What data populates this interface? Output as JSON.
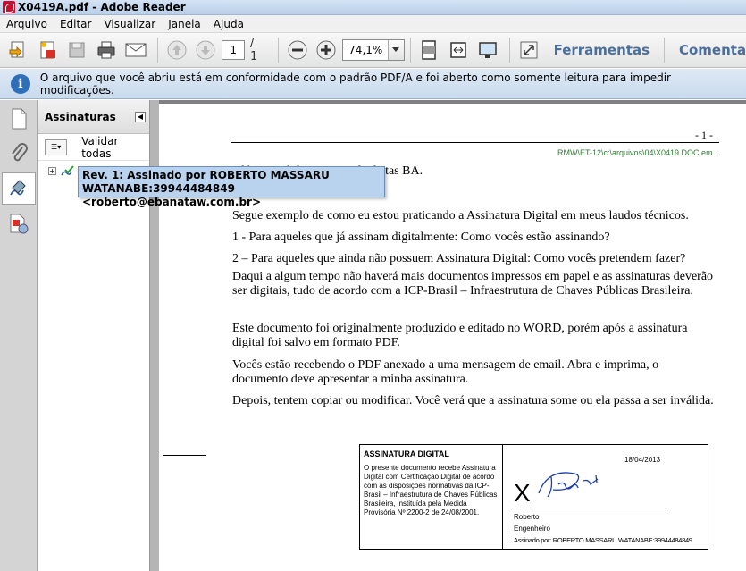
{
  "window": {
    "title": "X0419A.pdf - Adobe Reader"
  },
  "menu": [
    "Arquivo",
    "Editar",
    "Visualizar",
    "Janela",
    "Ajuda"
  ],
  "toolbar": {
    "page_current": "1",
    "page_total": "/ 1",
    "zoom": "74,1%",
    "tools_tab": "Ferramentas",
    "comment_tab": "Comenta"
  },
  "infobar": {
    "message": "O arquivo que você abriu está em conformidade com o padrão PDF/A e foi aberto como somente leitura para impedir modificações."
  },
  "signatures": {
    "title": "Assinaturas",
    "validate_all": "Validar todas"
  },
  "tooltip": {
    "line1": "Rev. 1: Assinado por ROBERTO MASSARU",
    "line2": "WATANABE:39944484849 <roberto@ebanataw.com.br>"
  },
  "document": {
    "page_number": "- 1 -",
    "header_path": "RMW\\ET-12\\c:\\arquivos\\04\\X0419.DOC em .",
    "greeting": "Olá pessoal do Grupo Calculistas BA.",
    "paragraphs": [
      "Segue exemplo de como eu estou praticando a Assinatura Digital em meus laudos técnicos.",
      "1 - Para aqueles que já assinam digitalmente: Como vocês estão assinando?",
      "2 – Para aqueles que ainda não possuem Assinatura Digital: Como vocês pretendem fazer?",
      "Daqui a algum tempo não haverá mais documentos impressos em papel e as assinaturas deverão ser digitais, tudo de acordo com a ICP-Brasil – Infraestrutura de Chaves Públicas Brasileira.",
      "Este documento foi originalmente produzido e editado no WORD, porém após a assinatura digital foi salvo em formato PDF.",
      "Vocês estão recebendo o PDF anexado a uma mensagem de email. Abra e imprima, o documento deve apresentar a minha assinatura.",
      "Depois, tentem copiar ou modificar. Você verá que a assinatura some ou ela passa a ser inválida."
    ],
    "sigbox": {
      "title": "ASSINATURA DIGITAL",
      "text": "O presente documento recebe Assinatura Digital com Certificação Digital de acordo com as disposições normativas da ICP-Brasil – Infraestrutura de Chaves Públicas Brasileira, instituída pela Medida Provisória Nº 2200-2 de 24/08/2001.",
      "date": "18/04/2013",
      "mark": "X",
      "name": "Roberto",
      "role": "Engenheiro",
      "signed_by": "Assinado por: ROBERTO MASSARU WATANABE:39944484849"
    }
  }
}
